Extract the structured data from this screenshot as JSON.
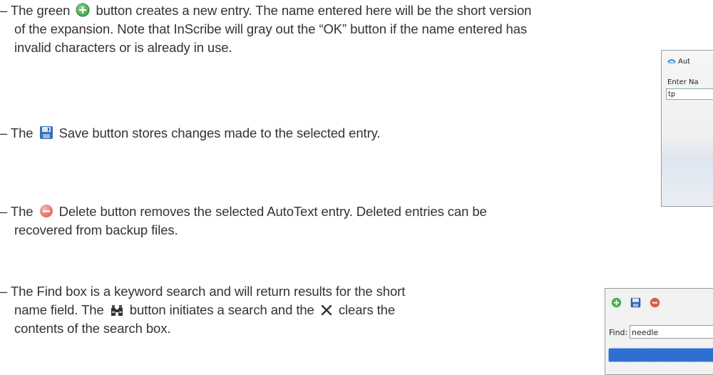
{
  "paragraphs": {
    "new_entry": {
      "line1_prefix": "– The green",
      "line1_suffix": "button creates a new entry.  The name entered here will be the short version",
      "line2": "of the expansion. Note that InScribe will gray out the “OK” button if the name entered has",
      "line3": "invalid characters or is already in use."
    },
    "save": {
      "prefix": "– The",
      "suffix": "Save button stores changes made to the selected entry."
    },
    "delete": {
      "line1_prefix": "– The",
      "line1_suffix": "Delete button removes the selected AutoText entry.  Deleted entries can be",
      "line2": "recovered from backup files."
    },
    "find": {
      "line1": "– The Find box is a keyword search and will return results for the short",
      "line2_prefix": "name field. The",
      "line2_middle": "button initiates a search and the",
      "line2_suffix": "clears the",
      "line3": "contents of the search box."
    }
  },
  "dialog_shot": {
    "title": "Aut",
    "label": "Enter Na",
    "input_value": "tp"
  },
  "toolbar_shot": {
    "find_label": "Find:",
    "find_value": "needle"
  },
  "icons": {
    "add": "add-circle-icon",
    "save": "floppy-disk-icon",
    "delete": "remove-circle-icon",
    "search": "binoculars-icon",
    "clear": "close-x-icon"
  },
  "colors": {
    "text": "#333333",
    "add_green": "#4caf50",
    "delete_red": "#e57368",
    "save_blue": "#3a6fb8",
    "selection": "#2f6fd1"
  }
}
